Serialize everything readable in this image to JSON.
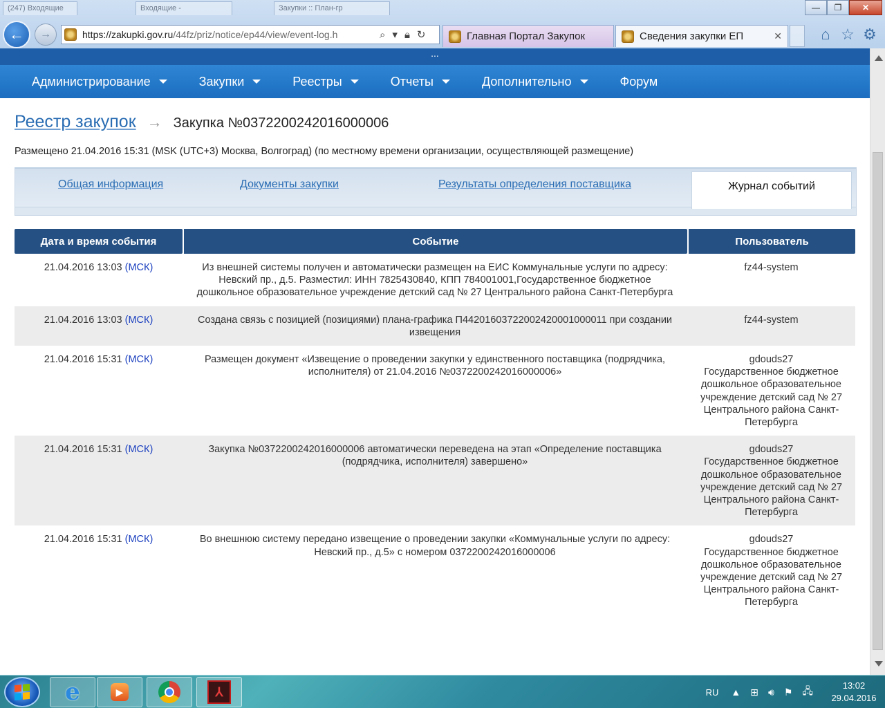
{
  "browser": {
    "background_tabs": [
      "(247) Входящие",
      "Входящие -",
      "Закупки :: План-гр"
    ],
    "window_buttons": {
      "minimize": "—",
      "restore": "❐",
      "close": "✕"
    },
    "url": "https://zakupki.gov.ru/44fz/priz/notice/ep44/view/event-log.h",
    "url_host": "https://zakupki.gov.ru",
    "url_path": "/44fz/priz/notice/ep44/view/event-log.h",
    "tabs": [
      {
        "label": "Главная Портал Закупок"
      },
      {
        "label": "Сведения закупки ЕП"
      }
    ],
    "tab_close": "✕",
    "icons": [
      "home-icon",
      "star-icon",
      "gear-icon"
    ]
  },
  "site": {
    "topstrip_text": "...",
    "nav": [
      {
        "label": "Администрирование",
        "dropdown": true
      },
      {
        "label": "Закупки",
        "dropdown": true
      },
      {
        "label": "Реестры",
        "dropdown": true
      },
      {
        "label": "Отчеты",
        "dropdown": true
      },
      {
        "label": "Дополнительно",
        "dropdown": true
      },
      {
        "label": "Форум",
        "dropdown": false
      }
    ]
  },
  "page": {
    "breadcrumb_link": "Реестр закупок",
    "breadcrumb_arrow": "→",
    "title": "Закупка №0372200242016000006",
    "posted": "Размещено 21.04.2016 15:31 (MSK (UTC+3) Москва, Волгоград) (по местному времени организации, осуществляющей размещение)",
    "tabs": [
      {
        "label": "Общая информация",
        "active": false
      },
      {
        "label": "Документы закупки",
        "active": false
      },
      {
        "label": "Результаты определения поставщика",
        "active": false
      },
      {
        "label": "Журнал событий",
        "active": true
      }
    ]
  },
  "events_table": {
    "headers": [
      "Дата и время события",
      "Событие",
      "Пользователь"
    ],
    "rows": [
      {
        "datetime": "21.04.2016 13:03",
        "tz": "(МСК)",
        "event": "Из внешней системы получен и автоматически размещен на ЕИС Коммунальные услуги по адресу: Невский пр., д.5. Разместил: ИНН 7825430840, КПП 784001001,Государственное бюджетное дошкольное образовательное учреждение детский сад № 27 Центрального района Санкт-Петербурга",
        "user": "fz44-system"
      },
      {
        "datetime": "21.04.2016 13:03",
        "tz": "(МСК)",
        "event": "Создана связь с позицией (позициями) плана-графика П44201603722002420001000011 при создании извещения",
        "user": "fz44-system"
      },
      {
        "datetime": "21.04.2016 15:31",
        "tz": "(МСК)",
        "event": "Размещен документ «Извещение о проведении закупки у единственного поставщика (подрядчика, исполнителя) от 21.04.2016 №0372200242016000006»",
        "user": "gdouds27",
        "org": "Государственное бюджетное дошкольное образовательное учреждение детский сад № 27 Центрального района Санкт-Петербурга"
      },
      {
        "datetime": "21.04.2016 15:31",
        "tz": "(МСК)",
        "event": "Закупка №0372200242016000006 автоматически переведена на этап «Определение поставщика (подрядчика, исполнителя) завершено»",
        "user": "gdouds27",
        "org": "Государственное бюджетное дошкольное образовательное учреждение детский сад № 27 Центрального района Санкт-Петербурга"
      },
      {
        "datetime": "21.04.2016 15:31",
        "tz": "(МСК)",
        "event": "Во внешнюю систему передано извещение о проведении закупки «Коммунальные услуги по адресу: Невский пр., д.5» с номером 0372200242016000006",
        "user": "gdouds27",
        "org": "Государственное бюджетное дошкольное образовательное учреждение детский сад № 27 Центрального района Санкт-Петербурга"
      }
    ]
  },
  "taskbar": {
    "apps": [
      "internet-explorer-icon",
      "media-player-icon",
      "chrome-icon",
      "acrobat-icon"
    ],
    "lang": "RU",
    "time": "13:02",
    "date": "29.04.2016"
  },
  "colors": {
    "nav_bg": "#1c6ec0",
    "table_header_bg": "#245083",
    "link": "#2a6db3",
    "row_alt": "#ececec"
  }
}
